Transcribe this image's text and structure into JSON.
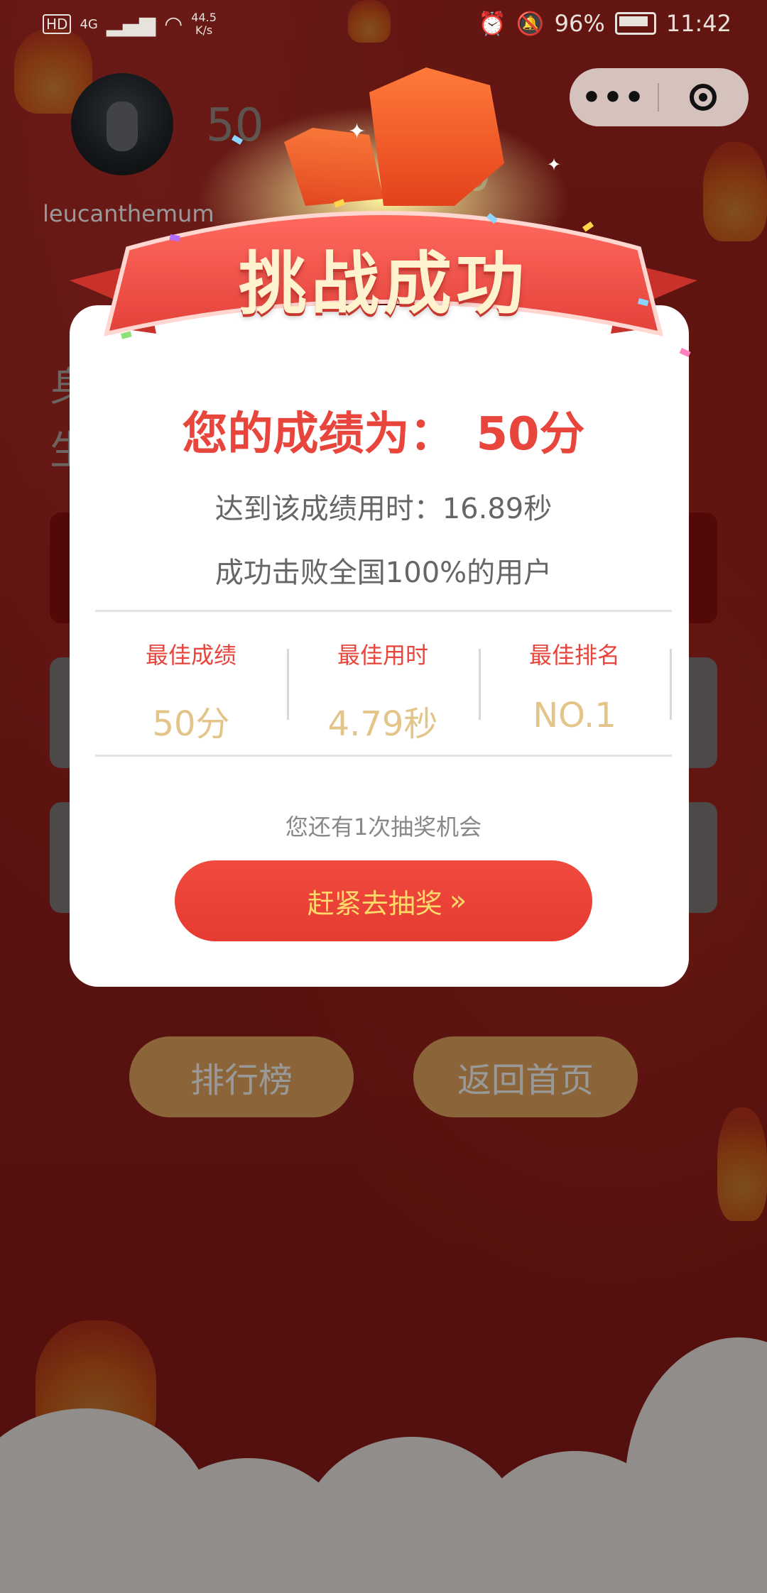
{
  "status_bar": {
    "net_label": "HD",
    "signal": "4G",
    "speed": "44.5",
    "speed_unit": "K/s",
    "battery": "96%",
    "time": "11:42"
  },
  "capsule": {
    "more": "•••"
  },
  "user": {
    "name": "leucanthemum",
    "score_left": "50",
    "score_right": "50"
  },
  "background_text": {
    "a": "身",
    "b": "生"
  },
  "modal": {
    "banner": "挑战成功",
    "result_label": "您的成绩为：",
    "result_score": "50分",
    "time_line": "达到该成绩用时：16.89秒",
    "beat_line": "成功击败全国100%的用户",
    "stats": [
      {
        "label": "最佳成绩",
        "value": "50分"
      },
      {
        "label": "最佳用时",
        "value": "4.79秒"
      },
      {
        "label": "最佳排名",
        "value": "NO.1"
      }
    ],
    "chance_text": "您还有1次抽奖机会",
    "lottery_button": "赶紧去抽奖",
    "lottery_chevron": "»"
  },
  "bottom": {
    "rank_button": "排行榜",
    "home_button": "返回首页"
  },
  "colors": {
    "accent_red": "#e8453c",
    "gold": "#e3c58a",
    "button_orange": "#e8a860"
  }
}
